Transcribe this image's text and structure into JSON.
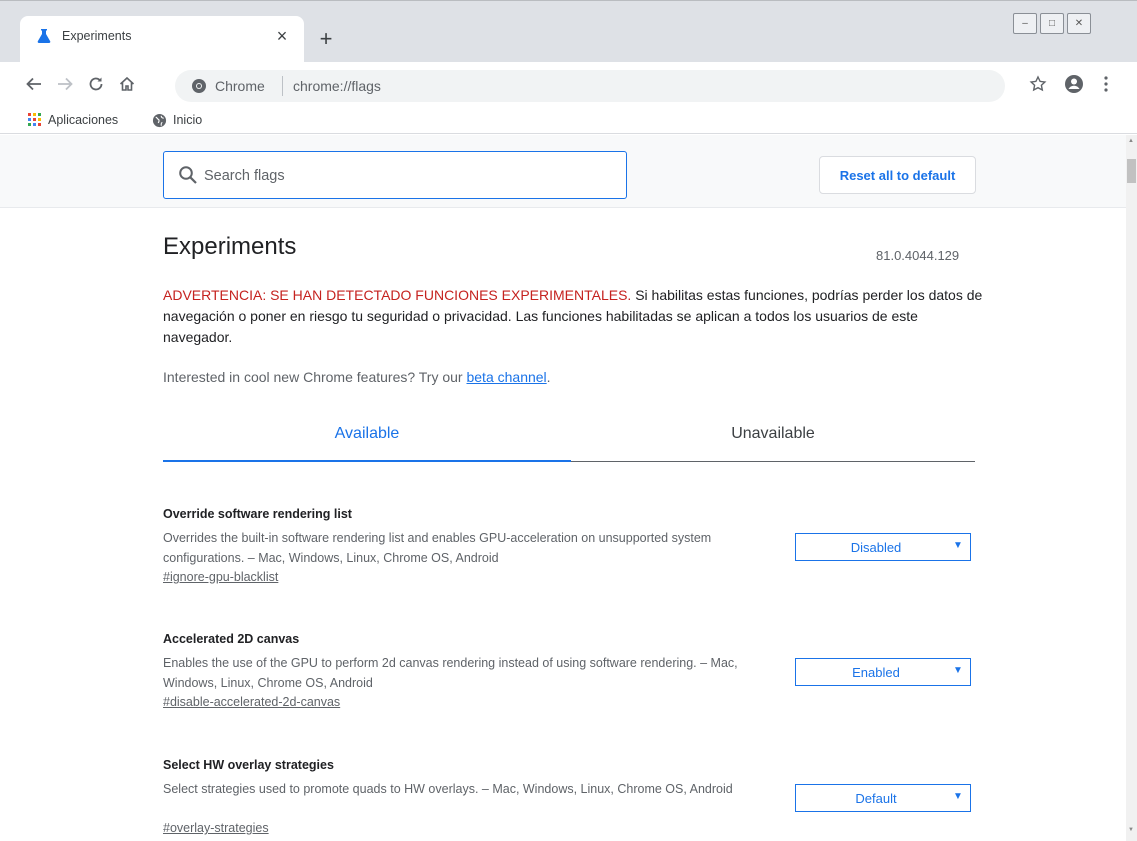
{
  "browser": {
    "tab": {
      "title": "Experiments",
      "close": "×"
    },
    "new_tab": "+",
    "window_controls": {
      "minimize": "–",
      "maximize": "□",
      "close": "✕"
    },
    "omnibox": {
      "site": "Chrome",
      "url": "chrome://flags"
    },
    "bookmarks": [
      {
        "label": "Aplicaciones",
        "icon": "apps-grid-icon"
      },
      {
        "label": "Inicio",
        "icon": "globe-icon"
      }
    ]
  },
  "search": {
    "placeholder": "Search flags"
  },
  "reset_button": "Reset all to default",
  "page": {
    "title": "Experiments",
    "version": "81.0.4044.129",
    "warning_prefix": "ADVERTENCIA: SE HAN DETECTADO FUNCIONES EXPERIMENTALES.",
    "warning_body": "Si habilitas estas funciones, podrías perder los datos de navegación o poner en riesgo tu seguridad o privacidad. Las funciones habilitadas se aplican a todos los usuarios de este navegador.",
    "beta_text": "Interested in cool new Chrome features? Try our",
    "beta_link": "beta channel",
    "beta_suffix": "."
  },
  "tabs": {
    "available": "Available",
    "unavailable": "Unavailable"
  },
  "flags": [
    {
      "name": "Override software rendering list",
      "description": "Overrides the built-in software rendering list and enables GPU-acceleration on unsupported system configurations. – Mac, Windows, Linux, Chrome OS, Android",
      "link": "#ignore-gpu-blacklist",
      "value": "Disabled"
    },
    {
      "name": "Accelerated 2D canvas",
      "description": "Enables the use of the GPU to perform 2d canvas rendering instead of using software rendering. – Mac, Windows, Linux, Chrome OS, Android",
      "link": "#disable-accelerated-2d-canvas",
      "value": "Enabled"
    },
    {
      "name": "Select HW overlay strategies",
      "description": "Select strategies used to promote quads to HW overlays. – Mac, Windows, Linux, Chrome OS, Android",
      "link": "#overlay-strategies",
      "value": "Default"
    }
  ],
  "colors": {
    "accent": "#1a73e8",
    "warning": "#c5221f",
    "tabstrip": "#dee1e6"
  }
}
